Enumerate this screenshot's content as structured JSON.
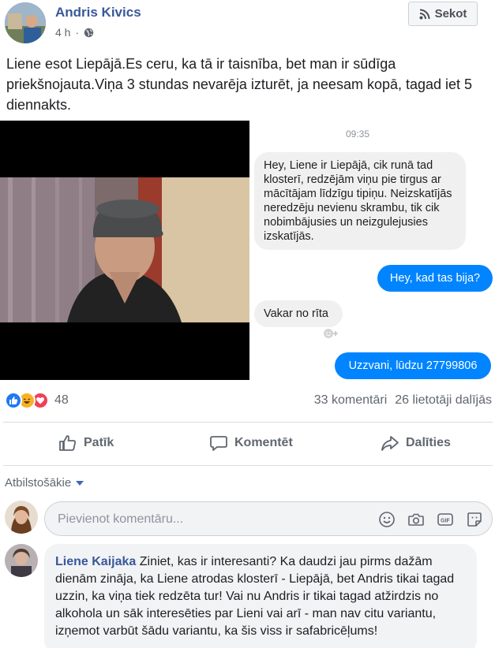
{
  "post": {
    "author": "Andris Kivics",
    "time": "4 h",
    "dot": "·",
    "follow_label": "Sekot",
    "text": "Liene esot Liepājā.Es ceru, ka tā ir taisnība, bet man ir sūdīga priekšnojauta.Viņa 3 stundas nevarēja izturēt, ja neesam kopā, tagad iet 5 diennakts."
  },
  "chat": {
    "time": "09:35",
    "messages": [
      {
        "side": "in",
        "text": "Hey, Liene ir Liepājā, cik runā tad klosterī, redzējām viņu pie tirgus ar mācītājam līdzīgu tipiņu. Neizskatījās neredzēju nevienu skrambu, tik cik nobimbājusies un neizgulejusies izskatījās."
      },
      {
        "side": "out",
        "text": "Hey, kad tas bija?"
      },
      {
        "side": "in",
        "text": "Vakar no rīta"
      },
      {
        "side": "out",
        "text": "Uzzvani, lūdzu 27799806"
      }
    ]
  },
  "stats": {
    "reaction_count": "48",
    "comments": "33 komentāri",
    "shares": "26 lietotāji dalījās",
    "reaction_colors": {
      "like": "#2078f4",
      "haha": "#f7b125",
      "love": "#f33e58"
    }
  },
  "actions": {
    "like": "Patīk",
    "comment": "Komentēt",
    "share": "Dalīties"
  },
  "comments_section": {
    "filter_label": "Atbilstošākie",
    "input_placeholder": "Pievienot komentāru...",
    "comments": [
      {
        "author": "Liene Kaijaka",
        "text": "Ziniet, kas ir interesanti? Ka daudzi jau pirms dažām dienām zināja, ka Liene atrodas klosterī - Liepājā, bet Andris tikai tagad uzzin, ka viņa tiek redzēta tur! Vai nu Andris ir tikai tagad atžirdzis no alkohola un sāk interesēties par Lieni vai arī - man nav citu variantu, izņemot varbūt šādu variantu, ka šis viss ir safabricēļums!"
      }
    ]
  }
}
